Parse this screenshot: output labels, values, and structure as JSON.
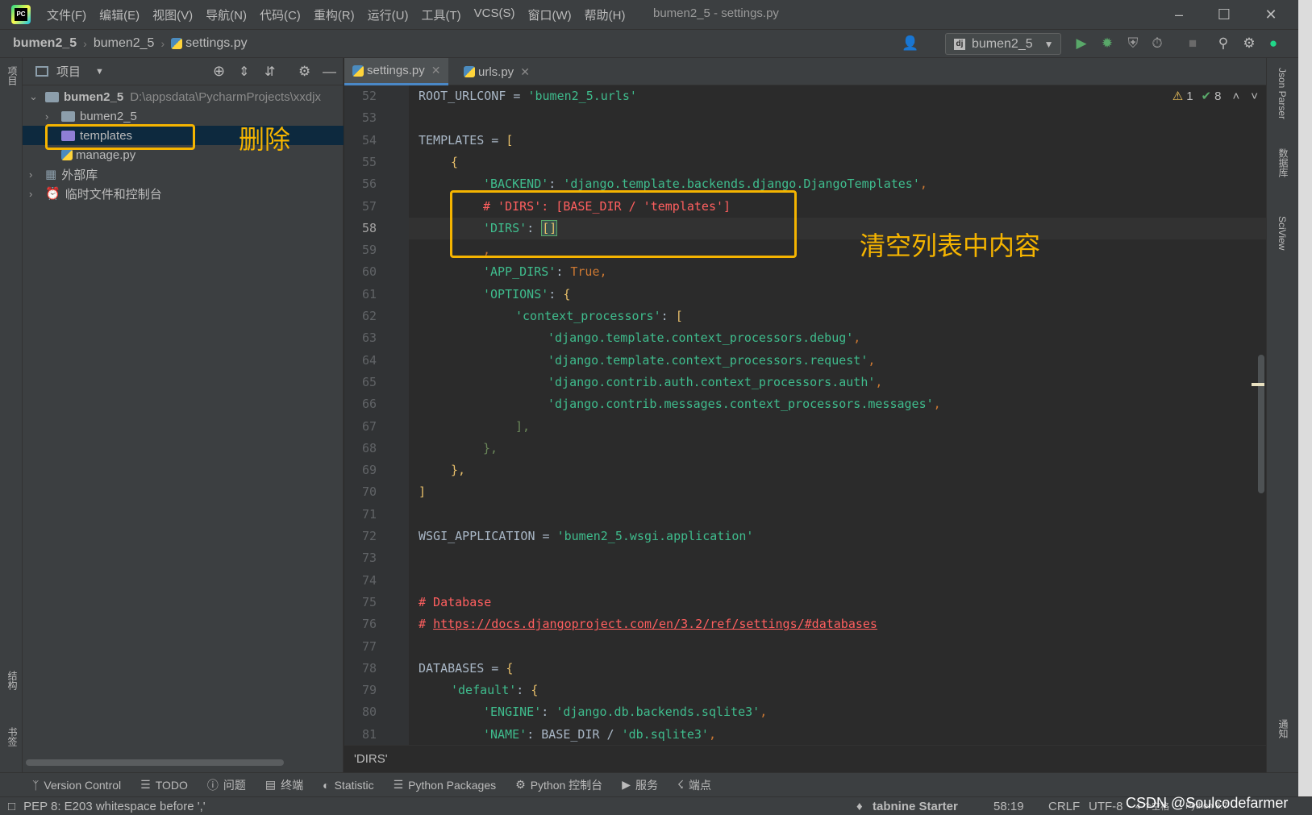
{
  "titlebar": {
    "menu": [
      "文件(F)",
      "编辑(E)",
      "视图(V)",
      "导航(N)",
      "代码(C)",
      "重构(R)",
      "运行(U)",
      "工具(T)",
      "VCS(S)",
      "窗口(W)",
      "帮助(H)"
    ],
    "window_title": "bumen2_5 - settings.py"
  },
  "navbar": {
    "crumbs": [
      "bumen2_5",
      "bumen2_5",
      "settings.py"
    ],
    "run_config": "bumen2_5"
  },
  "left_stripe": {
    "project": "项目",
    "structure": "结构",
    "bookmarks": "书签"
  },
  "project_panel": {
    "title": "项目",
    "root": "bumen2_5",
    "root_path": "D:\\appsdata\\PycharmProjects\\xxdjx",
    "items": [
      "bumen2_5",
      "templates",
      "manage.py"
    ],
    "external_libs": "外部库",
    "scratches": "临时文件和控制台"
  },
  "tabs": [
    "settings.py",
    "urls.py"
  ],
  "inspections": {
    "warnings": "1",
    "ok": "8"
  },
  "code": {
    "line_numbers": [
      "52",
      "53",
      "54",
      "55",
      "56",
      "57",
      "58",
      "59",
      "60",
      "61",
      "62",
      "63",
      "64",
      "65",
      "66",
      "67",
      "68",
      "69",
      "70",
      "71",
      "72",
      "73",
      "74",
      "75",
      "76",
      "77",
      "78",
      "79",
      "80",
      "81"
    ],
    "l52_a": "ROOT_URLCONF",
    "l52_b": " = ",
    "l52_c": "'bumen2_5.urls'",
    "l54_a": "TEMPLATES",
    "l54_b": " = ",
    "l54_c": "[",
    "l55_a": "{",
    "l56_a": "'BACKEND'",
    "l56_b": ": ",
    "l56_c": "'django.template.backends.django.DjangoTemplates'",
    "l56_d": ",",
    "l57_a": "# 'DIRS': [BASE_DIR / 'templates']",
    "l58_a": "'DIRS'",
    "l58_b": ": ",
    "l58_c": "[]",
    "l59_a": ",",
    "l60_a": "'APP_DIRS'",
    "l60_b": ": ",
    "l60_c": "True",
    "l60_d": ",",
    "l61_a": "'OPTIONS'",
    "l61_b": ": ",
    "l61_c": "{",
    "l62_a": "'context_processors'",
    "l62_b": ": ",
    "l62_c": "[",
    "l63_a": "'django.template.context_processors.debug'",
    "l63_b": ",",
    "l64_a": "'django.template.context_processors.request'",
    "l64_b": ",",
    "l65_a": "'django.contrib.auth.context_processors.auth'",
    "l65_b": ",",
    "l66_a": "'django.contrib.messages.context_processors.messages'",
    "l66_b": ",",
    "l67_a": "],",
    "l68_a": "},",
    "l69_a": "},",
    "l70_a": "]",
    "l72_a": "WSGI_APPLICATION",
    "l72_b": " = ",
    "l72_c": "'bumen2_5.wsgi.application'",
    "l75_a": "# Database",
    "l76_a": "# ",
    "l76_b": "https://docs.djangoproject.com/en/3.2/ref/settings/#databases",
    "l78_a": "DATABASES",
    "l78_b": " = ",
    "l78_c": "{",
    "l79_a": "'default'",
    "l79_b": ": ",
    "l79_c": "{",
    "l80_a": "'ENGINE'",
    "l80_b": ": ",
    "l80_c": "'django.db.backends.sqlite3'",
    "l80_d": ",",
    "l81_a": "'NAME'",
    "l81_b": ": ",
    "l81_c": "BASE_DIR",
    "l81_d": " / ",
    "l81_e": "'db.sqlite3'",
    "l81_f": ","
  },
  "editor_breadcrumb": "'DIRS'",
  "right_stripe": {
    "json": "Json Parser",
    "db": "数据库",
    "sciview": "SciView",
    "notifications": "通知"
  },
  "bottom_tools": [
    "Version Control",
    "TODO",
    "问题",
    "终端",
    "Statistic",
    "Python Packages",
    "Python 控制台",
    "服务",
    "端点"
  ],
  "status": {
    "message": "PEP 8: E203 whitespace before ','",
    "tabnine": "tabnine Starter",
    "position": "58:19",
    "line_sep": "CRLF",
    "encoding": "UTF-8",
    "indent": "4 个空格",
    "interpreter": "Python 3.7",
    "watermark": "CSDN @Soulcodefarmer"
  },
  "annotations": {
    "delete": "删除",
    "clear": "清空列表中内容"
  },
  "colors": {
    "annotation": "#f5b400",
    "bg": "#2b2b2b",
    "panel": "#3c3f41"
  }
}
